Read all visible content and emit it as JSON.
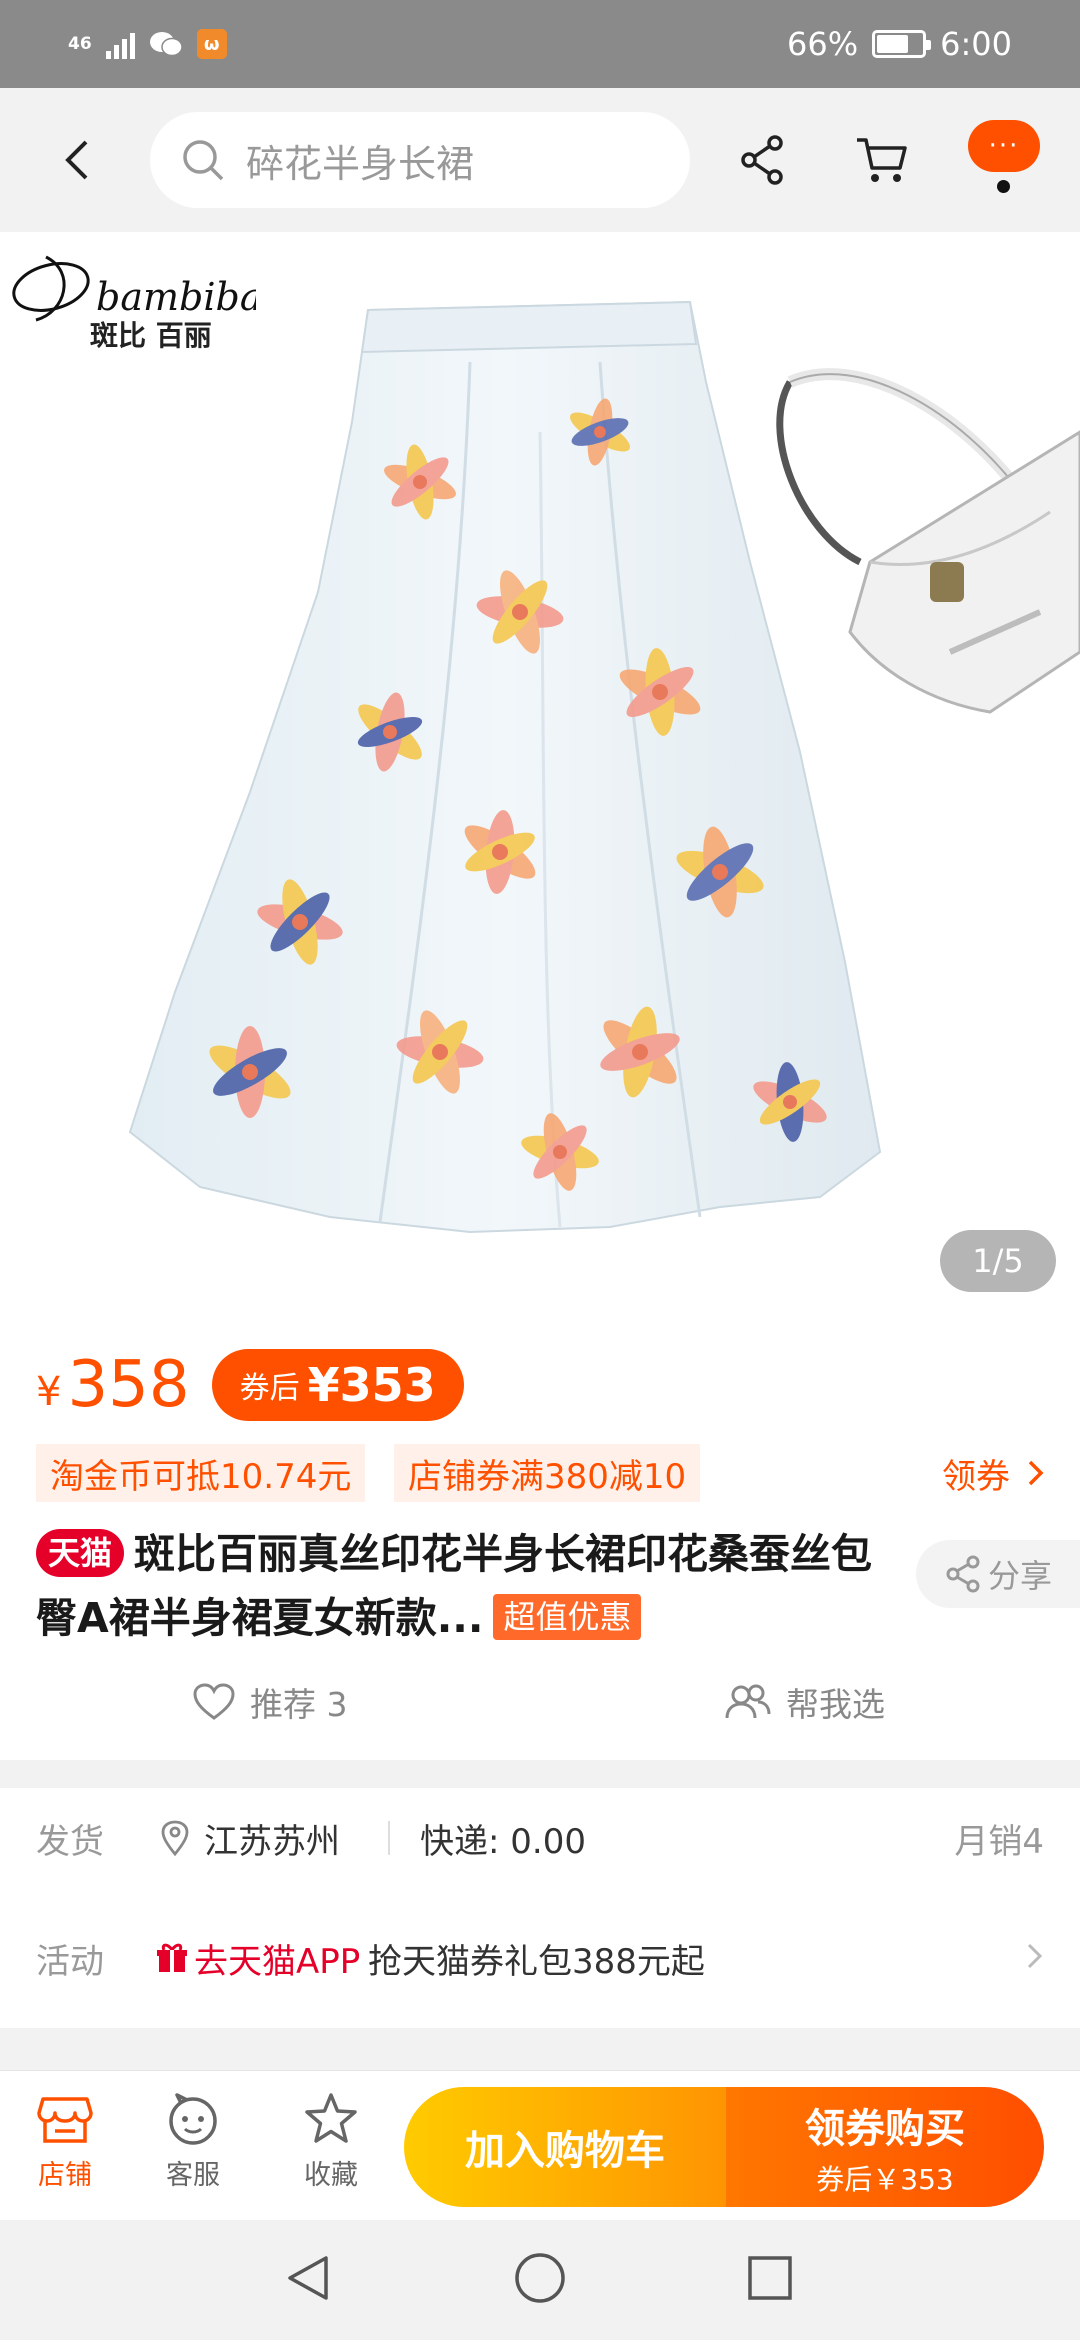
{
  "status_bar": {
    "network": "46",
    "battery_text": "66%",
    "battery_level": 0.66,
    "time": "6:00"
  },
  "nav": {
    "search_placeholder": "碎花半身长裙",
    "more_label": "···"
  },
  "image": {
    "brand_name": "bambibaili",
    "brand_cn": "斑比 百丽",
    "page_indicator": "1/5",
    "current_page": 1,
    "total_pages": 5
  },
  "product": {
    "currency": "¥",
    "price": "358",
    "after_coupon_label": "券后",
    "after_coupon_price": "¥353",
    "coupon_tags": [
      "淘金币可抵10.74元",
      "店铺券满380减10"
    ],
    "get_coupon_label": "领券",
    "platform_badge": "天猫",
    "title": "斑比百丽真丝印花半身长裙印花桑蚕丝包臀A裙半身裙夏女新款...",
    "deal_badge": "超值优惠",
    "share_label": "分享",
    "recommend_label": "推荐 3",
    "help_pick_label": "帮我选"
  },
  "shipping": {
    "label": "发货",
    "location": "江苏苏州",
    "express": "快递: 0.00",
    "monthly_sales": "月销4"
  },
  "activity": {
    "label": "活动",
    "app_tag": "去天猫APP",
    "text": "抢天猫券礼包388元起"
  },
  "bottom_bar": {
    "shop_label": "店铺",
    "service_label": "客服",
    "favorite_label": "收藏",
    "add_cart_label": "加入购物车",
    "buy_label": "领券购买",
    "buy_sub_label": "券后￥353"
  },
  "colors": {
    "accent": "#ff5000",
    "tmall_red": "#e5002a",
    "cart_gradient": [
      "#ffcb00",
      "#ff9402"
    ],
    "buy_gradient": [
      "#ff7700",
      "#ff4e00"
    ]
  }
}
